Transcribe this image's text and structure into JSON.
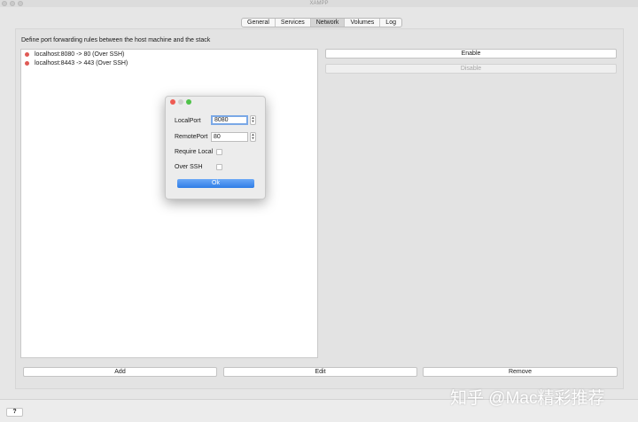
{
  "window": {
    "title": "XAMPP"
  },
  "tabs": [
    {
      "label": "General",
      "active": false
    },
    {
      "label": "Services",
      "active": false
    },
    {
      "label": "Network",
      "active": true
    },
    {
      "label": "Volumes",
      "active": false
    },
    {
      "label": "Log",
      "active": false
    }
  ],
  "network": {
    "description": "Define port forwarding rules between the host machine and the stack",
    "rules": [
      {
        "label": "localhost:8080 -> 80 (Over SSH)",
        "status_color": "#e05a55"
      },
      {
        "label": "localhost:8443 -> 443 (Over SSH)",
        "status_color": "#e05a55"
      }
    ],
    "enable_label": "Enable",
    "disable_label": "Disable",
    "add_label": "Add",
    "edit_label": "Edit",
    "remove_label": "Remove"
  },
  "dialog": {
    "local_port_label": "LocalPort",
    "local_port_value": "8080",
    "remote_port_label": "RemotePort",
    "remote_port_value": "80",
    "require_local_label": "Require Local",
    "require_local_checked": false,
    "over_ssh_label": "Over SSH",
    "over_ssh_checked": false,
    "ok_label": "Ok"
  },
  "footer": {
    "help_label": "?"
  },
  "watermark": "知乎 @Mac精彩推荐",
  "colors": {
    "accent": "#3a85ea",
    "status_red": "#e05a55"
  }
}
